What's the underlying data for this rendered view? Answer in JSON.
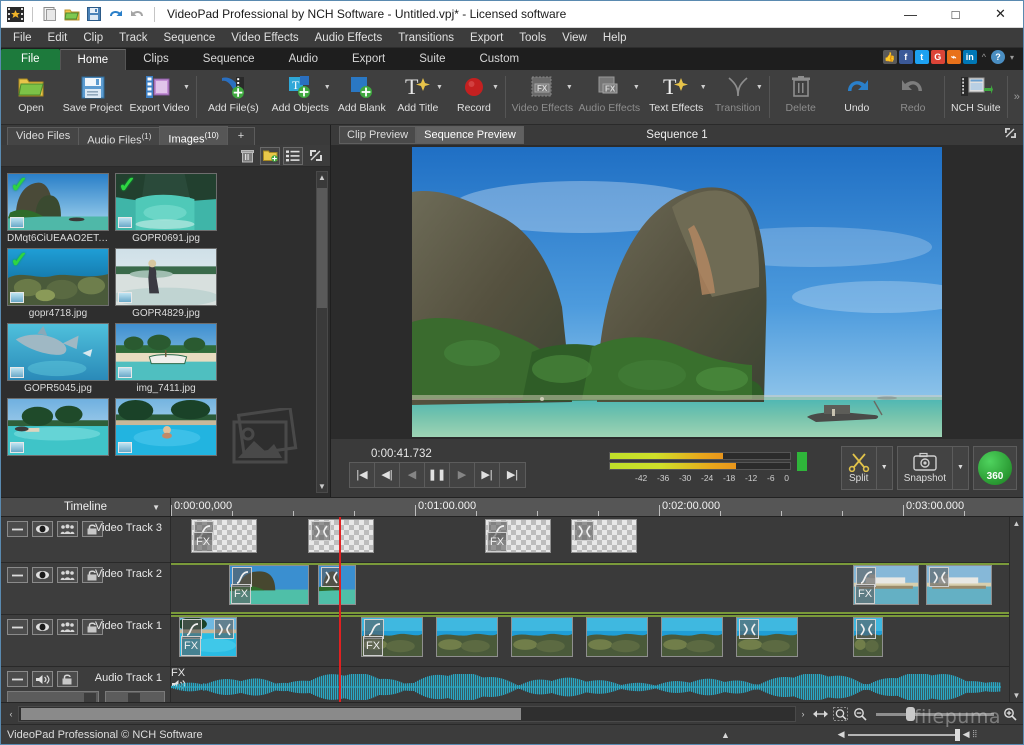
{
  "window": {
    "title": "VideoPad Professional by NCH Software - Untitled.vpj* - Licensed software",
    "quick_access": [
      "new-icon",
      "open-icon",
      "folder-icon",
      "save-icon",
      "undo-icon",
      "redo-icon"
    ],
    "minimize": "—",
    "maximize": "□",
    "close": "✕"
  },
  "menu": {
    "items": [
      "File",
      "Edit",
      "Clip",
      "Track",
      "Sequence",
      "Video Effects",
      "Audio Effects",
      "Transitions",
      "Export",
      "Tools",
      "View",
      "Help"
    ]
  },
  "ribbon": {
    "tabs": [
      {
        "label": "File",
        "state": "file"
      },
      {
        "label": "Home",
        "state": "active"
      },
      {
        "label": "Clips",
        "state": "normal"
      },
      {
        "label": "Sequence",
        "state": "normal"
      },
      {
        "label": "Audio",
        "state": "normal"
      },
      {
        "label": "Export",
        "state": "normal"
      },
      {
        "label": "Suite",
        "state": "normal"
      },
      {
        "label": "Custom",
        "state": "normal"
      }
    ],
    "social": [
      {
        "name": "thumbs-up-icon",
        "glyph": "👍",
        "color": "#5a5a5a"
      },
      {
        "name": "facebook-icon",
        "glyph": "f",
        "color": "#3b5998"
      },
      {
        "name": "twitter-icon",
        "glyph": "t",
        "color": "#1da1f2"
      },
      {
        "name": "google-plus-icon",
        "glyph": "G",
        "color": "#db4437"
      },
      {
        "name": "share-icon",
        "glyph": "⌁",
        "color": "#e8711a"
      },
      {
        "name": "linkedin-icon",
        "glyph": "in",
        "color": "#0077b5"
      }
    ],
    "help_caret": "^",
    "help_icon": "?",
    "help_dropdown": "▾",
    "buttons": [
      {
        "label": "Open",
        "icon": "open-folder-icon",
        "dropdown": false,
        "dim": false
      },
      {
        "label": "Save Project",
        "icon": "save-disk-icon",
        "dropdown": false,
        "dim": false
      },
      {
        "label": "Export Video",
        "icon": "export-film-icon",
        "dropdown": true,
        "dim": false
      },
      {
        "label": "Add File(s)",
        "icon": "add-file-icon",
        "dropdown": false,
        "dim": false
      },
      {
        "label": "Add Objects",
        "icon": "add-object-icon",
        "dropdown": true,
        "dim": false
      },
      {
        "label": "Add Blank",
        "icon": "add-blank-icon",
        "dropdown": false,
        "dim": false
      },
      {
        "label": "Add Title",
        "icon": "add-title-icon",
        "dropdown": true,
        "dim": false
      },
      {
        "label": "Record",
        "icon": "record-icon",
        "dropdown": true,
        "dim": false
      },
      {
        "label": "Video Effects",
        "icon": "video-fx-icon",
        "dropdown": true,
        "dim": true
      },
      {
        "label": "Audio Effects",
        "icon": "audio-fx-icon",
        "dropdown": true,
        "dim": true
      },
      {
        "label": "Text Effects",
        "icon": "text-fx-icon",
        "dropdown": true,
        "dim": false
      },
      {
        "label": "Transition",
        "icon": "transition-icon",
        "dropdown": true,
        "dim": true
      },
      {
        "label": "Delete",
        "icon": "trash-icon",
        "dropdown": false,
        "dim": true
      },
      {
        "label": "Undo",
        "icon": "undo-arrow-icon",
        "dropdown": false,
        "dim": false
      },
      {
        "label": "Redo",
        "icon": "redo-arrow-icon",
        "dropdown": false,
        "dim": true
      },
      {
        "label": "NCH Suite",
        "icon": "nch-suite-icon",
        "dropdown": false,
        "dim": false
      }
    ],
    "overflow": "»"
  },
  "browser": {
    "tabs": [
      {
        "label": "Video Files",
        "count": "",
        "active": false
      },
      {
        "label": "Audio Files",
        "count": "(1)",
        "active": false
      },
      {
        "label": "Images",
        "count": "(10)",
        "active": true
      }
    ],
    "add_tab": "+",
    "tools": [
      {
        "name": "delete-icon",
        "glyph": "🗑"
      },
      {
        "name": "add-folder-icon",
        "glyph": "🗂"
      },
      {
        "name": "list-view-icon",
        "glyph": "☰"
      },
      {
        "name": "detach-panel-icon",
        "glyph": "⇱"
      }
    ],
    "files": [
      {
        "name": "DMqt6CiUEAAO2ET.jpg",
        "checked": true,
        "art": "cliff-sea"
      },
      {
        "name": "GOPR0691.jpg",
        "checked": true,
        "art": "lagoon"
      },
      {
        "name": "gopr4718.jpg",
        "checked": true,
        "art": "reef"
      },
      {
        "name": "GOPR4829.jpg",
        "checked": false,
        "art": "beach-walk"
      },
      {
        "name": "GOPR5045.jpg",
        "checked": false,
        "art": "dolphin"
      },
      {
        "name": "img_7411.jpg",
        "checked": false,
        "art": "boat-beach"
      },
      {
        "name": "",
        "checked": false,
        "art": "island"
      },
      {
        "name": "",
        "checked": false,
        "art": "pool"
      }
    ],
    "scroll_up": "▲",
    "scroll_down": "▼"
  },
  "preview": {
    "tabs": [
      {
        "label": "Clip Preview",
        "active": false
      },
      {
        "label": "Sequence Preview",
        "active": true
      }
    ],
    "sequence_title": "Sequence 1",
    "detach_icon": "⇱",
    "timecode": "0:00:41.732",
    "transport": [
      {
        "name": "skip-start-button",
        "glyph": "|◀",
        "dim": false
      },
      {
        "name": "prev-frame-button",
        "glyph": "◀|",
        "dim": false
      },
      {
        "name": "step-back-button",
        "glyph": "◀",
        "dim": true
      },
      {
        "name": "pause-button",
        "glyph": "❚❚",
        "dim": false
      },
      {
        "name": "play-button",
        "glyph": "▶",
        "dim": true
      },
      {
        "name": "next-frame-button",
        "glyph": "▶|",
        "dim": false
      },
      {
        "name": "skip-end-button",
        "glyph": "▶|",
        "dim": false
      }
    ],
    "meter": {
      "ticks": [
        "-42",
        "-36",
        "-30",
        "-24",
        "-18",
        "-12",
        "-6",
        "0"
      ],
      "channel_top_pct": 63,
      "channel_bottom_pct": 70,
      "peak_color": "#2fb53a"
    },
    "split_label": "Split",
    "snapshot_label": "Snapshot",
    "badge_360": "360"
  },
  "timeline": {
    "label": "Timeline",
    "caret": "▼",
    "ruler_labels": [
      "0:00:00,000",
      "0:01:00.000",
      "0:02:00.000",
      "0:03:00.000"
    ],
    "tracks": [
      {
        "name": "Video Track 3",
        "type": "video",
        "controls": [
          "minus-icon",
          "eye-icon",
          "people-icon",
          "lock-icon"
        ]
      },
      {
        "name": "Video Track 2",
        "type": "video",
        "controls": [
          "minus-icon",
          "eye-icon",
          "people-icon",
          "lock-icon"
        ]
      },
      {
        "name": "Video Track 1",
        "type": "video",
        "controls": [
          "minus-icon",
          "eye-icon",
          "people-icon",
          "lock-icon"
        ]
      },
      {
        "name": "Audio Track 1",
        "type": "audio",
        "controls": [
          "minus-icon",
          "speaker-icon",
          "lock-icon"
        ]
      }
    ],
    "clip_badges": {
      "fade": "⟋",
      "cross": "✕",
      "fx": "FX",
      "speaker": "🔊"
    },
    "scroll_up": "▲",
    "scroll_down": "▼"
  },
  "bottom": {
    "scroll_left": "‹",
    "scroll_right": "›",
    "fit_icon": "↔",
    "zoom_selection_icon": "⧉",
    "zoom_out_icon": "⊖",
    "zoom_in_icon": "⊕",
    "zoom_slider_value": 25
  },
  "status": {
    "text": "VideoPad Professional © NCH Software",
    "collapse_icon": "▲",
    "volume_low_icon": "◀",
    "volume_high_icon": "◀",
    "grip_icon": "⦙⦙",
    "watermark": "filepuma"
  },
  "colors": {
    "accent_green": "#1d7a3c",
    "playhead": "#e02020",
    "waveform": "#2aa8c4",
    "selection": "#7a9a3a",
    "window_border": "#5a8ab0"
  }
}
